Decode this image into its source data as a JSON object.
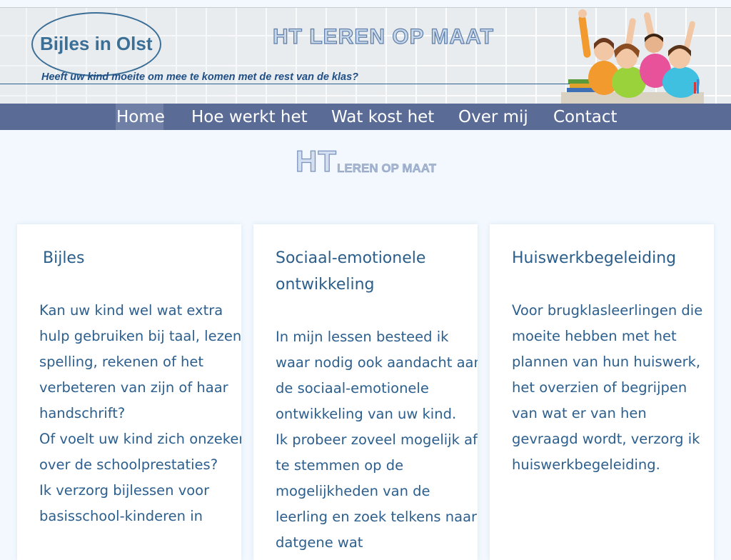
{
  "header": {
    "logo_text": "Bijles in Olst",
    "brand_title": "HT LEREN OP MAAT",
    "tagline": "Heeft uw kind moeite om mee te komen met de rest van de klas?"
  },
  "nav": {
    "items": [
      {
        "label": "Home",
        "active": true
      },
      {
        "label": "Hoe werkt het",
        "active": false
      },
      {
        "label": "Wat kost het",
        "active": false
      },
      {
        "label": "Over mij",
        "active": false
      },
      {
        "label": "Contact",
        "active": false
      }
    ]
  },
  "page_logo": {
    "big": "HT",
    "small": "LEREN OP MAAT"
  },
  "cards": [
    {
      "title": "Bijles",
      "paragraphs": [
        "Kan uw kind wel wat extra hulp gebruiken bij taal, lezen, spelling, rekenen of het verbeteren van zijn of haar handschrift?",
        "Of voelt uw kind zich onzeker over de schoolprestaties?",
        "Ik verzorg bijlessen voor basisschool-kinderen in"
      ]
    },
    {
      "title": "Sociaal-emotionele ontwikkeling",
      "paragraphs": [
        "In mijn lessen besteed ik waar nodig ook aandacht aan de sociaal-emotionele ontwikkeling van uw kind.",
        "Ik probeer zoveel mogelijk af te stemmen op de mogelijkheden van de leerling en zoek telkens naar datgene wat"
      ]
    },
    {
      "title": "Huiswerkbegeleiding",
      "paragraphs": [
        "Voor brugklasleerlingen die moeite hebben met het plannen van hun huiswerk, het overzien of begrijpen van wat er van hen gevraagd wordt, verzorg ik huiswerkbegeleiding."
      ]
    }
  ],
  "colors": {
    "nav_background": "#5a6b96",
    "nav_active": "#6f7fa6",
    "text_blue": "#2c5f8e",
    "page_background": "#f2f8fe"
  }
}
